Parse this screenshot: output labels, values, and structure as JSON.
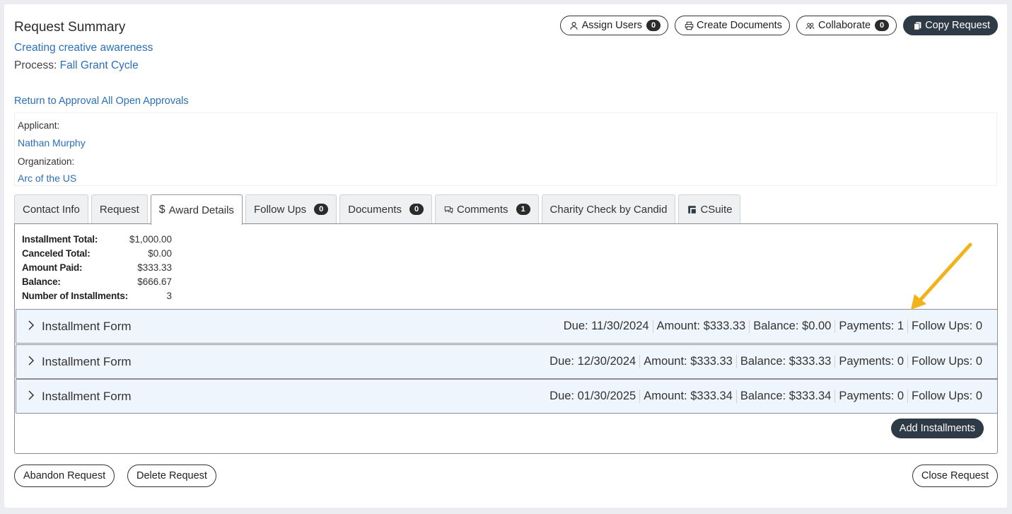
{
  "header": {
    "title": "Request Summary",
    "request_name": "Creating creative awareness",
    "process_label": "Process:",
    "process_name": "Fall Grant Cycle",
    "return_link": "Return to Approval All Open Approvals"
  },
  "actions": {
    "assign_users": {
      "label": "Assign Users",
      "count": "0"
    },
    "create_documents": {
      "label": "Create Documents"
    },
    "collaborate": {
      "label": "Collaborate",
      "count": "0"
    },
    "copy_request": {
      "label": "Copy Request"
    }
  },
  "applicant": {
    "applicant_label": "Applicant:",
    "applicant_name": "Nathan Murphy",
    "organization_label": "Organization:",
    "organization_name": "Arc of the US"
  },
  "tabs": {
    "contact_info": {
      "label": "Contact Info"
    },
    "request": {
      "label": "Request"
    },
    "award_details": {
      "label": "Award Details",
      "icon": "$"
    },
    "follow_ups": {
      "label": "Follow Ups",
      "count": "0"
    },
    "documents": {
      "label": "Documents",
      "count": "0"
    },
    "comments": {
      "label": "Comments",
      "count": "1"
    },
    "charity_check": {
      "label": "Charity Check by Candid"
    },
    "csuite": {
      "label": "CSuite"
    }
  },
  "summary": [
    {
      "label": "Installment Total:",
      "value": "$1,000.00"
    },
    {
      "label": "Canceled Total:",
      "value": "$0.00"
    },
    {
      "label": "Amount Paid:",
      "value": "$333.33"
    },
    {
      "label": "Balance:",
      "value": "$666.67"
    },
    {
      "label": "Number of Installments:",
      "value": "3"
    }
  ],
  "installments": [
    {
      "name": "Installment Form",
      "due": "Due: 11/30/2024",
      "amount": "Amount: $333.33",
      "balance": "Balance: $0.00",
      "payments": "Payments: 1",
      "follow_ups": "Follow Ups: 0"
    },
    {
      "name": "Installment Form",
      "due": "Due: 12/30/2024",
      "amount": "Amount: $333.33",
      "balance": "Balance: $333.33",
      "payments": "Payments: 0",
      "follow_ups": "Follow Ups: 0"
    },
    {
      "name": "Installment Form",
      "due": "Due: 01/30/2025",
      "amount": "Amount: $333.34",
      "balance": "Balance: $333.34",
      "payments": "Payments: 0",
      "follow_ups": "Follow Ups: 0"
    }
  ],
  "buttons": {
    "add_installments": "Add Installments",
    "abandon_request": "Abandon Request",
    "delete_request": "Delete Request",
    "close_request": "Close Request"
  },
  "colors": {
    "accent_link": "#2a6fba",
    "dark_button": "#2e3a46",
    "installment_bg": "#eef5fc",
    "annotation_arrow": "#f2b21a"
  }
}
